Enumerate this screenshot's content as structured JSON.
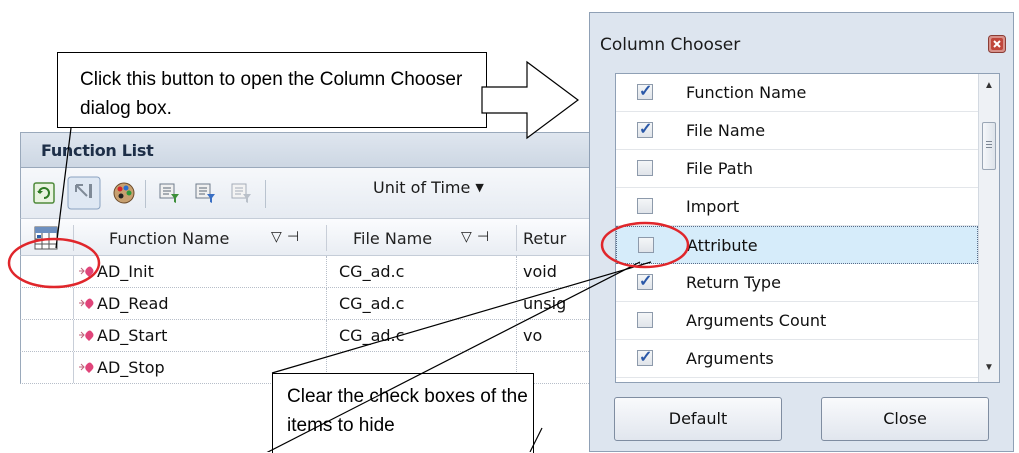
{
  "function_list": {
    "title": "Function List",
    "toolbar": {
      "unit_of_time_label": "Unit of Time",
      "icons": [
        "refresh-icon",
        "jump-icon",
        "color-palette-icon",
        "function-filter-icon",
        "function-filter-alt-icon",
        "function-filter-disabled-icon"
      ]
    },
    "columns": [
      {
        "label": "Function Name"
      },
      {
        "label": "File Name"
      },
      {
        "label": "Retur"
      }
    ],
    "rows": [
      {
        "function": "AD_Init",
        "file": "CG_ad.c",
        "return": "void"
      },
      {
        "function": "AD_Read",
        "file": "CG_ad.c",
        "return": "unsig"
      },
      {
        "function": "AD_Start",
        "file": "CG_ad.c",
        "return": "vo"
      },
      {
        "function": "AD_Stop",
        "file": "",
        "return": ""
      }
    ]
  },
  "column_chooser": {
    "title": "Column Chooser",
    "items": [
      {
        "label": "Function Name",
        "checked": true
      },
      {
        "label": "File Name",
        "checked": true
      },
      {
        "label": "File Path",
        "checked": false
      },
      {
        "label": "Import",
        "checked": false
      },
      {
        "label": "Attribute",
        "checked": false,
        "selected": true
      },
      {
        "label": "Return Type",
        "checked": true
      },
      {
        "label": "Arguments Count",
        "checked": false
      },
      {
        "label": "Arguments",
        "checked": true
      }
    ],
    "default_button": "Default",
    "close_button": "Close"
  },
  "callouts": {
    "top": "Click this button to open the Column Chooser dialog box.",
    "bottom": "Clear the check boxes of the items to hide"
  },
  "colors": {
    "highlight_circle": "#e0262b",
    "selected_row": "#d6ecfa",
    "checkmark": "#2a58a8"
  }
}
